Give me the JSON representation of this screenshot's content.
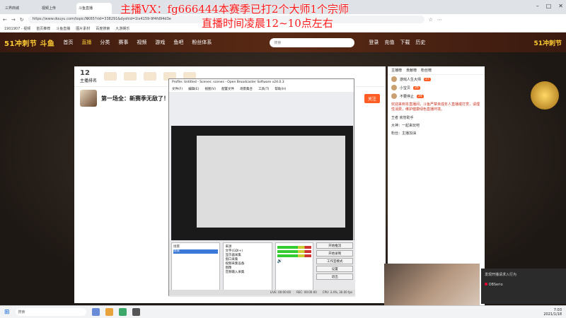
{
  "browser": {
    "tabs": [
      {
        "label": "三界商城",
        "active": false
      },
      {
        "label": "视频上传",
        "active": false
      },
      {
        "label": "斗鱼直播",
        "active": true
      }
    ],
    "address": "https://www.douyu.com/topic/NK65?rid=338291&dyshid=1lx4159-9f4fd94d3e",
    "bookmarks": [
      "1901907 - 视频",
      "首页推荐",
      "斗鱼直播",
      "图片素材",
      "百度搜索",
      "九游娱乐"
    ]
  },
  "site": {
    "logo": "51冲刺节 斗鱼",
    "nav": [
      "首页",
      "直播",
      "分类",
      "赛事",
      "视频",
      "游戏",
      "鱼吧",
      "粉丝体系"
    ],
    "active_nav": "直播",
    "search_placeholder": "搜索",
    "header_icons": [
      "登录",
      "充值",
      "下载",
      "历史"
    ],
    "right_logo": "51冲刺节"
  },
  "room": {
    "rank": "12",
    "rank_label": "主播排名",
    "title": "第一场全：新赛季无敌了！",
    "follow_label": "关注"
  },
  "obs": {
    "title": "Profile: Untitled - Scenes: scenes - Open Broadcaster Software v24.0.3",
    "menu": [
      "文件(F)",
      "编辑(E)",
      "视图(V)",
      "配置文件",
      "场景集合",
      "工具(T)",
      "帮助(H)"
    ],
    "scenes_title": "场景",
    "scene_items": [
      "场景"
    ],
    "sources_title": "来源",
    "source_items": [
      "文字(GDI+)",
      "显示器采集",
      "窗口采集",
      "视频采集设备",
      "图像",
      "音频输入采集"
    ],
    "buttons": [
      "开始推流",
      "开始录制",
      "工作室模式",
      "设置",
      "退出"
    ],
    "status": {
      "live": "LIVE: 00:00:00",
      "rec": "REC: 00:00:00",
      "cpu": "CPU: 3.4%, 30.00 fps"
    }
  },
  "sidebar": {
    "tabs": [
      "主播榜",
      "贡献榜",
      "粉丝榜"
    ],
    "rank_items": [
      {
        "name": "游戏人生大师",
        "badge": "27"
      },
      {
        "name": "小宝贝",
        "badge": "26"
      },
      {
        "name": "不要停止",
        "badge": "24"
      }
    ],
    "chat_notice": "欢迎来到本直播间，斗鱼严禁未成年人直播或打赏，请理性消费，维护健康绿色直播环境。",
    "chat_items": [
      "王者  房管助手",
      "大神：一起来玩吧",
      "粉丝：主播加油"
    ]
  },
  "toast": {
    "title": "发现开播请求入行为",
    "app": "OBSerio"
  },
  "overlay": {
    "line1": "主播VX：fg666444本赛季已打2个大师1个宗师",
    "line2": "直播时间凌晨12~10点左右"
  },
  "taskbar": {
    "search": "搜索",
    "time": "7:03",
    "date": "2021/1/18"
  },
  "colors": {
    "accent": "#ff5d23",
    "overlay": "#ff1a1a",
    "gold": "#ffcc33"
  }
}
